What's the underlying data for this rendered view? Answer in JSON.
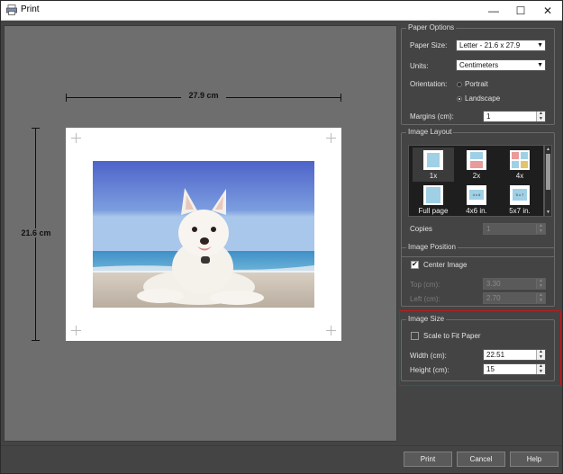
{
  "window": {
    "title": "Print",
    "app_icon": "printer-icon",
    "minimize": "—",
    "maximize": "☐",
    "close": "✕"
  },
  "preview": {
    "width_label": "27.9 cm",
    "height_label": "21.6 cm"
  },
  "paper_options": {
    "title": "Paper Options",
    "paper_size_label": "Paper Size:",
    "paper_size_value": "Letter - 21.6 x 27.9",
    "units_label": "Units:",
    "units_value": "Centimeters",
    "orientation_label": "Orientation:",
    "portrait_label": "Portrait",
    "landscape_label": "Landscape",
    "orientation_selected": "Landscape",
    "margins_label": "Margins (cm):",
    "margins_value": "1"
  },
  "image_layout": {
    "title": "Image Layout",
    "tiles": [
      {
        "label": "1x",
        "icon": "layout-1x-icon"
      },
      {
        "label": "2x",
        "icon": "layout-2x-icon"
      },
      {
        "label": "4x",
        "icon": "layout-4x-icon"
      },
      {
        "label": "Full page",
        "icon": "layout-full-page-icon"
      },
      {
        "label": "4x6 in.",
        "icon": "layout-4x6-icon",
        "thumb_text": "4 x 6"
      },
      {
        "label": "5x7 in.",
        "icon": "layout-5x7-icon",
        "thumb_text": "5 x 7"
      }
    ],
    "selected": "1x",
    "copies_label": "Copies",
    "copies_value": "1"
  },
  "image_position": {
    "title": "Image Position",
    "center_label": "Center Image",
    "center_checked": true,
    "top_label": "Top (cm):",
    "top_value": "3.30",
    "left_label": "Left (cm):",
    "left_value": "2.70"
  },
  "image_size": {
    "title": "Image Size",
    "scale_label": "Scale to Fit Paper",
    "scale_checked": false,
    "width_label": "Width (cm):",
    "width_value": "22.51",
    "height_label": "Height (cm):",
    "height_value": "15"
  },
  "buttons": {
    "print": "Print",
    "cancel": "Cancel",
    "help": "Help"
  },
  "colors": {
    "accent_highlight": "#c0191b",
    "panel_bg": "#444444",
    "preview_bg": "#6e6e6e"
  }
}
